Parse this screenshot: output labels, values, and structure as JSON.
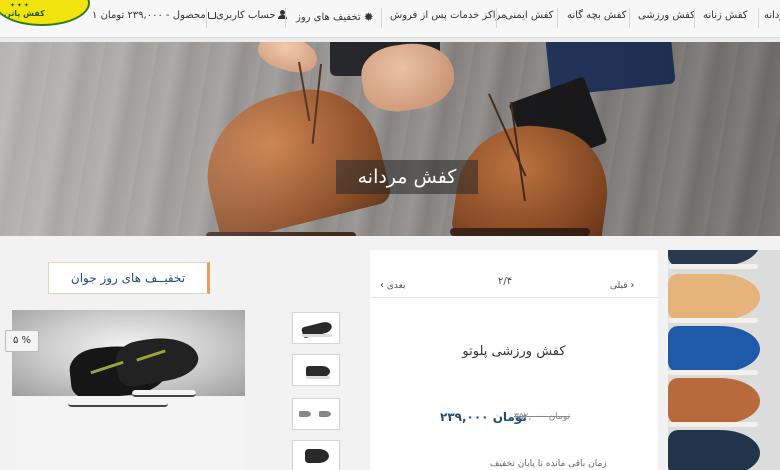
{
  "nav": {
    "items": [
      {
        "label": "کفش مردانه",
        "name": "nav-men-shoes"
      },
      {
        "label": "کفش زنانه",
        "name": "nav-women-shoes"
      },
      {
        "label": "کفش ورزشی",
        "name": "nav-sport-shoes"
      },
      {
        "label": "کفش بچه گانه",
        "name": "nav-kids-shoes"
      },
      {
        "label": "کفش ایمنی",
        "name": "nav-safety-shoes"
      },
      {
        "label": "مراکز خدمات پس از فروش",
        "name": "nav-service-centers"
      },
      {
        "label": "تخفیف های روز",
        "name": "nav-daily-deals"
      }
    ],
    "account_label": "حساب کاربری",
    "cart_label": "۱ محصول - ۲۳۹,۰۰۰ تومان"
  },
  "logo": {
    "text": "کفش پاتن"
  },
  "hero": {
    "title": "کفش مردانه"
  },
  "product_card": {
    "pager_count": "۲/۴",
    "prev_label": "قبلی",
    "next_label": "بعدی",
    "name": "کفش ورزشی پلوتو",
    "old_price": "۳۵۲,۰۰۰ تومان",
    "new_price": "۲۳۹,۰۰۰ تومان",
    "remaining_label": "زمان باقی مانده تا پایان تخفیف"
  },
  "deal": {
    "title": "تخفیــف های روز جوان",
    "discount_badge": "۵ %"
  },
  "colors": {
    "accent": "#1e4c74",
    "logo_yellow": "#f3e40e",
    "logo_green": "#2f7a22",
    "badge_orange": "#e0a062"
  },
  "icons": [
    "gear-icon",
    "user-icon",
    "cart-icon",
    "chevron-left-icon",
    "chevron-right-icon"
  ]
}
